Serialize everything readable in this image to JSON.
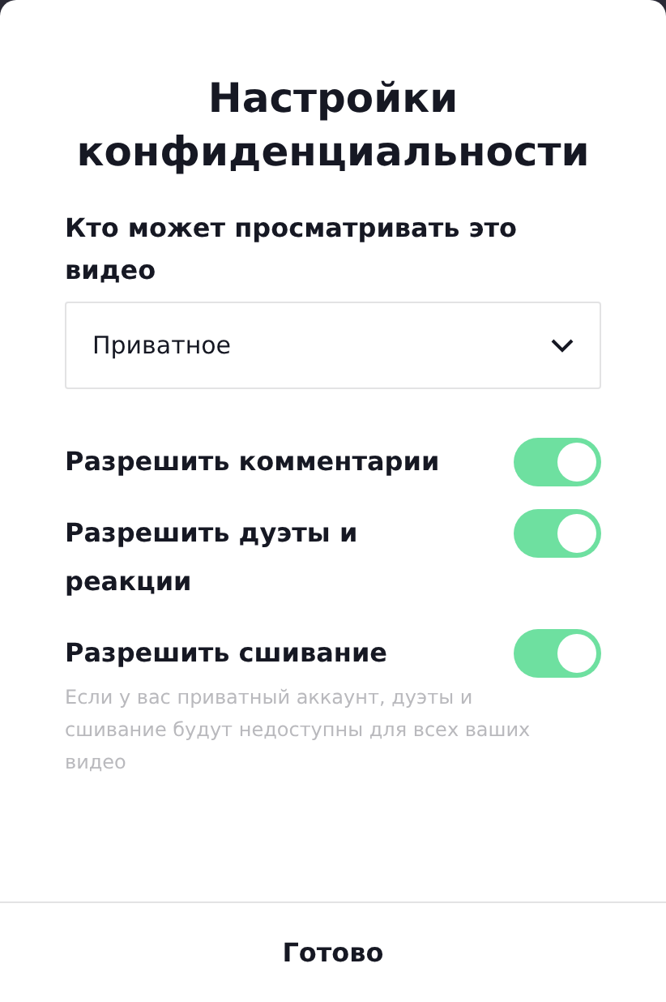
{
  "title": "Настройки конфиденциальности",
  "visibility": {
    "label": "Кто может просматривать это видео",
    "value": "Приватное"
  },
  "toggles": [
    {
      "label": "Разрешить комментарии",
      "on": true
    },
    {
      "label": "Разрешить дуэты и реакции",
      "on": true
    },
    {
      "label": "Разрешить сшивание",
      "on": true
    }
  ],
  "hint": "Если у вас приватный аккаунт, дуэты и сшивание будут недоступны для всех ваших видео",
  "done_button": "Готово"
}
